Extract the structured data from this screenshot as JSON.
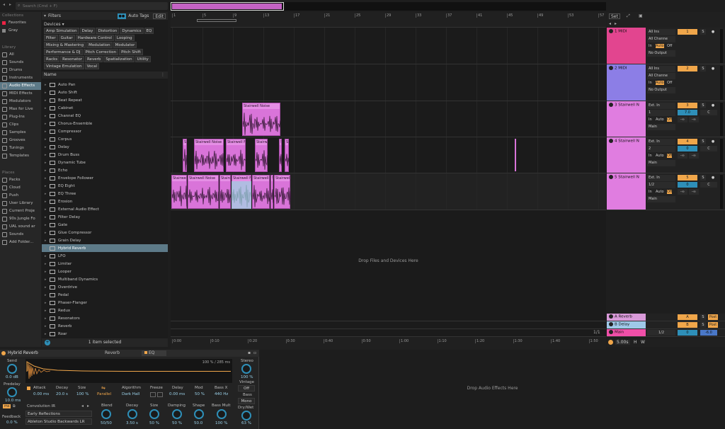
{
  "search": {
    "placeholder": "Search (Cmd + F)"
  },
  "sidebar": {
    "collections_heading": "Collections",
    "collections": [
      "Favorites",
      "Gray"
    ],
    "library_heading": "Library",
    "library": [
      {
        "label": "All",
        "icon": "list-icon"
      },
      {
        "label": "Sounds",
        "icon": "note-icon"
      },
      {
        "label": "Drums",
        "icon": "drum-icon"
      },
      {
        "label": "Instruments",
        "icon": "keyboard-icon"
      },
      {
        "label": "Audio Effects",
        "icon": "audio-effect-icon"
      },
      {
        "label": "MIDI Effects",
        "icon": "midi-effect-icon"
      },
      {
        "label": "Modulators",
        "icon": "modulator-icon"
      },
      {
        "label": "Max for Live",
        "icon": "max-icon"
      },
      {
        "label": "Plug-Ins",
        "icon": "plugin-icon"
      },
      {
        "label": "Clips",
        "icon": "clip-icon"
      },
      {
        "label": "Samples",
        "icon": "wave-icon"
      },
      {
        "label": "Grooves",
        "icon": "groove-icon"
      },
      {
        "label": "Tunings",
        "icon": "tuning-icon"
      },
      {
        "label": "Templates",
        "icon": "template-icon"
      }
    ],
    "places_heading": "Places",
    "places": [
      "Packs",
      "Cloud",
      "Push",
      "User Library",
      "Current Proje",
      "90s Jungle Fo",
      "UAL sound ar",
      "Sounds",
      "Add Folder..."
    ]
  },
  "browser": {
    "filters_label": "Filters",
    "auto_tags_label": "Auto Tags",
    "edit_label": "Edit",
    "devices_label": "Devices",
    "tag_rows": [
      [
        "Amp Simulation",
        "Delay",
        "Distortion",
        "Dynamics",
        "EQ"
      ],
      [
        "Filter",
        "Guitar",
        "Hardware Control",
        "Looping"
      ],
      [
        "Mixing & Mastering",
        "Modulation",
        "Modulator"
      ],
      [
        "Performance & DJ",
        "Pitch Correction",
        "Pitch Shift"
      ],
      [
        "Racks",
        "Resonator",
        "Reverb",
        "Spatialization",
        "Utility"
      ],
      [
        "Vintage Emulation",
        "Vocal"
      ]
    ],
    "name_header": "Name",
    "items": [
      "Auto Pan",
      "Auto Shift",
      "Beat Repeat",
      "Cabinet",
      "Channel EQ",
      "Chorus-Ensemble",
      "Compressor",
      "Corpus",
      "Delay",
      "Drum Buss",
      "Dynamic Tube",
      "Echo",
      "Envelope Follower",
      "EQ Eight",
      "EQ Three",
      "Erosion",
      "External Audio Effect",
      "Filter Delay",
      "Gate",
      "Glue Compressor",
      "Grain Delay",
      "Hybrid Reverb",
      "LFO",
      "Limiter",
      "Looper",
      "Multiband Dynamics",
      "Overdrive",
      "Pedal",
      "Phaser-Flanger",
      "Redux",
      "Resonators",
      "Reverb",
      "Roar"
    ],
    "selected_item": "Hybrid Reverb",
    "status": "1 item selected"
  },
  "ruler": {
    "bars": [
      "1",
      "5",
      "9",
      "13",
      "17",
      "21",
      "25",
      "29",
      "33",
      "37",
      "41",
      "45",
      "49",
      "53",
      "57"
    ],
    "times": [
      "0:00",
      "0:10",
      "0:20",
      "0:30",
      "0:40",
      "0:50",
      "1:00",
      "1:10",
      "1:20",
      "1:30",
      "1:40",
      "1:50"
    ],
    "page": "1/1"
  },
  "arrangement": {
    "drop_text": "Drop Files and Devices Here"
  },
  "tracks": [
    {
      "name": "1 MIDI",
      "color": "#e2458f",
      "input": "All Ins",
      "channel": "All Channe",
      "output": "No Output",
      "number": "1"
    },
    {
      "name": "2 MIDI",
      "color": "#8c7ee6",
      "input": "All Ins",
      "channel": "All Channe",
      "output": "No Output",
      "number": "2"
    },
    {
      "name": "3 Stairwell N",
      "color": "#e07de0",
      "input": "Ext. In",
      "channel": "1",
      "output": "Main",
      "number": "3",
      "vol": "7.0",
      "pan": "C"
    },
    {
      "name": "4 Stairwell N",
      "color": "#e07de0",
      "input": "Ext. In",
      "channel": "2",
      "output": "Main",
      "number": "4",
      "vol": "0",
      "pan": "C"
    },
    {
      "name": "5 Stairwell N",
      "color": "#e07de0",
      "input": "Ext. In",
      "channel": "1/2",
      "output": "Main",
      "number": "5",
      "vol": "0",
      "pan": "C"
    }
  ],
  "io_labels": {
    "in": "In",
    "auto": "Auto",
    "off": "Off",
    "neg_inf": "-∞",
    "solo": "S",
    "post": "Post"
  },
  "clip_name": "Stairwell Noise",
  "returns": [
    {
      "name": "A Reverb",
      "color": "#d99ad9",
      "number": "A"
    },
    {
      "name": "B Delay",
      "color": "#9ec8e8",
      "number": "B"
    },
    {
      "name": "Main",
      "color": "#f04fa8",
      "number": "1/2",
      "vol": "0",
      "pan": "-6.0"
    }
  ],
  "set_label": "Set",
  "zoom_value": "5.00s",
  "hw": [
    "H",
    "W"
  ],
  "device": {
    "name": "Hybrid Reverb",
    "tabs": [
      "Reverb",
      "EQ"
    ],
    "send_label": "Send",
    "send_value": "0.0 dB",
    "predelay_label": "Predelay",
    "predelay_value": "10.0 ms",
    "feedback_label": "Feedback",
    "feedback_value": "0.0 %",
    "ms_label": "ms",
    "env_readout": "100 % / 285 ms",
    "attack_label": "Attack",
    "attack_value": "0.00 ms",
    "decay_label": "Decay",
    "decay_value": "20.0 s",
    "size_label": "Size",
    "size_value": "100 %",
    "routing_value": "Parallel",
    "algorithm_label": "Algorithm",
    "algorithm_value": "Dark Hall",
    "freeze_label": "Freeze",
    "delay_label": "Delay",
    "delay_value": "0.00 ms",
    "mod_label": "Mod",
    "mod_value": "50 %",
    "bassx_label": "Bass X",
    "bassx_value": "440 Hz",
    "convolution_label": "Convolution IR",
    "ir_category": "Early Reflections",
    "ir_name": "Ableton Studio Backwards LR",
    "blend_label": "Blend",
    "blend_value": "50/50",
    "decay2_label": "Decay",
    "decay2_value": "3.50 s",
    "size2_label": "Size",
    "size2_value": "50 %",
    "damping_label": "Damping",
    "damping_value": "50 %",
    "shape_label": "Shape",
    "shape_value": "50.0",
    "bassmult_label": "Bass Mult",
    "bassmult_value": "100 %",
    "stereo_label": "Stereo",
    "stereo_value": "100 %",
    "vintage_label": "Vintage",
    "vintage_value": "Off",
    "bass_label": "Bass",
    "bass_value": "Mono",
    "drywet_label": "Dry/Wet",
    "drywet_value": "63 %"
  },
  "device_drop_text": "Drop Audio Effects Here"
}
